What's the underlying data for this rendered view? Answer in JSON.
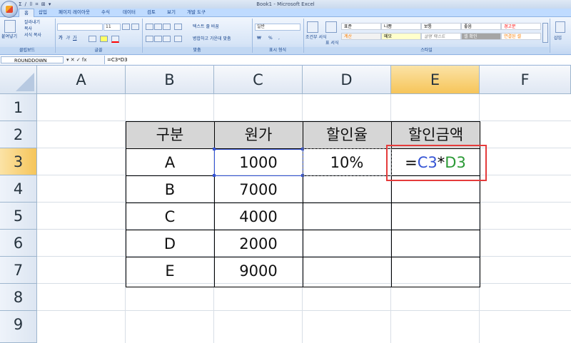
{
  "window": {
    "title": "Book1 - Microsoft Excel"
  },
  "qat": {
    "glyphs": "Σ ∕ ⌷ ⌗ ⊞ ▾"
  },
  "tabs": [
    "홈",
    "삽입",
    "페이지 레이아웃",
    "수식",
    "데이터",
    "검토",
    "보기",
    "개발 도구"
  ],
  "ribbon": {
    "clipboard": {
      "paste": "붙여넣기",
      "cut": "잘라내기",
      "copy": "복사",
      "format_painter": "서식 복사",
      "label": "클립보드"
    },
    "font": {
      "size": "11",
      "label": "글꼴",
      "bold": "가",
      "italic": "가",
      "underline": "가"
    },
    "alignment": {
      "wrap": "텍스트 줄 바꿈",
      "merge": "병합하고 가운데 맞춤",
      "label": "맞춤"
    },
    "number": {
      "format": "일반",
      "currency": "₩",
      "percent": "%",
      "comma": ",",
      "label": "표시 형식"
    },
    "cond_format": {
      "format": "조건부 서식",
      "table": "표 서식"
    },
    "styles": {
      "label": "스타일",
      "cells": [
        {
          "text": "표준",
          "bg": "#ffffff",
          "color": "#000000"
        },
        {
          "text": "나쁨",
          "bg": "#ffffff",
          "color": "#000000"
        },
        {
          "text": "보통",
          "bg": "#ffffff",
          "color": "#000000"
        },
        {
          "text": "좋음",
          "bg": "#ffffff",
          "color": "#000000"
        },
        {
          "text": "경고문",
          "bg": "#ffffff",
          "color": "#ff0000"
        },
        {
          "text": "계산",
          "bg": "#f2f2f2",
          "color": "#fa7d00"
        },
        {
          "text": "메모",
          "bg": "#ffffcc",
          "color": "#000000"
        },
        {
          "text": "설명 텍스트",
          "bg": "#ffffff",
          "color": "#7f7f7f"
        },
        {
          "text": "셀 확인",
          "bg": "#a5a5a5",
          "color": "#ffffff"
        },
        {
          "text": "연결된 셀",
          "bg": "#ffffff",
          "color": "#fa7d00"
        }
      ]
    },
    "cells_group": {
      "insert": "삽입"
    }
  },
  "formula_bar": {
    "name_box": "ROUNDDOWN",
    "buttons": "▾ ✕ ✓ fx",
    "formula": "=C3*D3"
  },
  "columns": [
    "A",
    "B",
    "C",
    "D",
    "E",
    "F"
  ],
  "rows": [
    "1",
    "2",
    "3",
    "4",
    "5",
    "6",
    "7",
    "8",
    "9"
  ],
  "table": {
    "headers": [
      "구분",
      "원가",
      "할인율",
      "할인금액"
    ],
    "rows": [
      [
        "A",
        "1000",
        "10%",
        ""
      ],
      [
        "B",
        "7000",
        "",
        ""
      ],
      [
        "C",
        "4000",
        "",
        ""
      ],
      [
        "D",
        "2000",
        "",
        ""
      ],
      [
        "E",
        "9000",
        "",
        ""
      ]
    ]
  },
  "edit_cell": {
    "prefix": "=",
    "ref1": "C3",
    "op": "*",
    "ref2": "D3",
    "ref1_color": "#3554d4",
    "ref2_color": "#2b9a36"
  },
  "colors": {
    "selected_header": "#f6c55a",
    "callout_red": "#e53b3b"
  }
}
